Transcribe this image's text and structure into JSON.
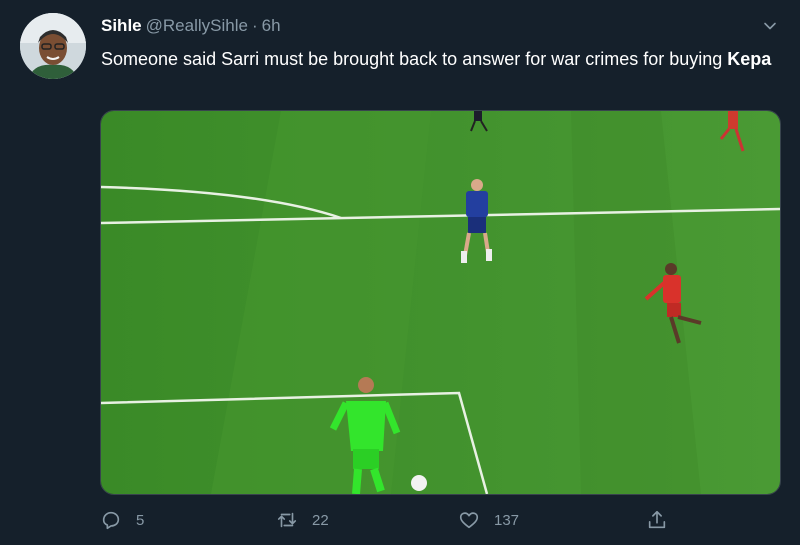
{
  "tweet": {
    "author_name": "Sihle",
    "handle": "@ReallySihle",
    "separator": "·",
    "time": "6h",
    "text_main": "Someone said Sarri must be brought back to answer for war crimes for buying ",
    "text_bold": "Kepa"
  },
  "actions": {
    "reply_count": "5",
    "retweet_count": "22",
    "like_count": "137"
  },
  "icons": {
    "menu": "chevron-down-icon",
    "reply": "reply-icon",
    "retweet": "retweet-icon",
    "like": "heart-icon",
    "share": "share-icon"
  },
  "colors": {
    "background": "#15202b",
    "text_secondary": "#8899a6",
    "pitch_green": "#3f8f2c",
    "goalkeeper_kit": "#33e52c",
    "away_kit": "#d9322b",
    "home_kit": "#233f9f"
  }
}
